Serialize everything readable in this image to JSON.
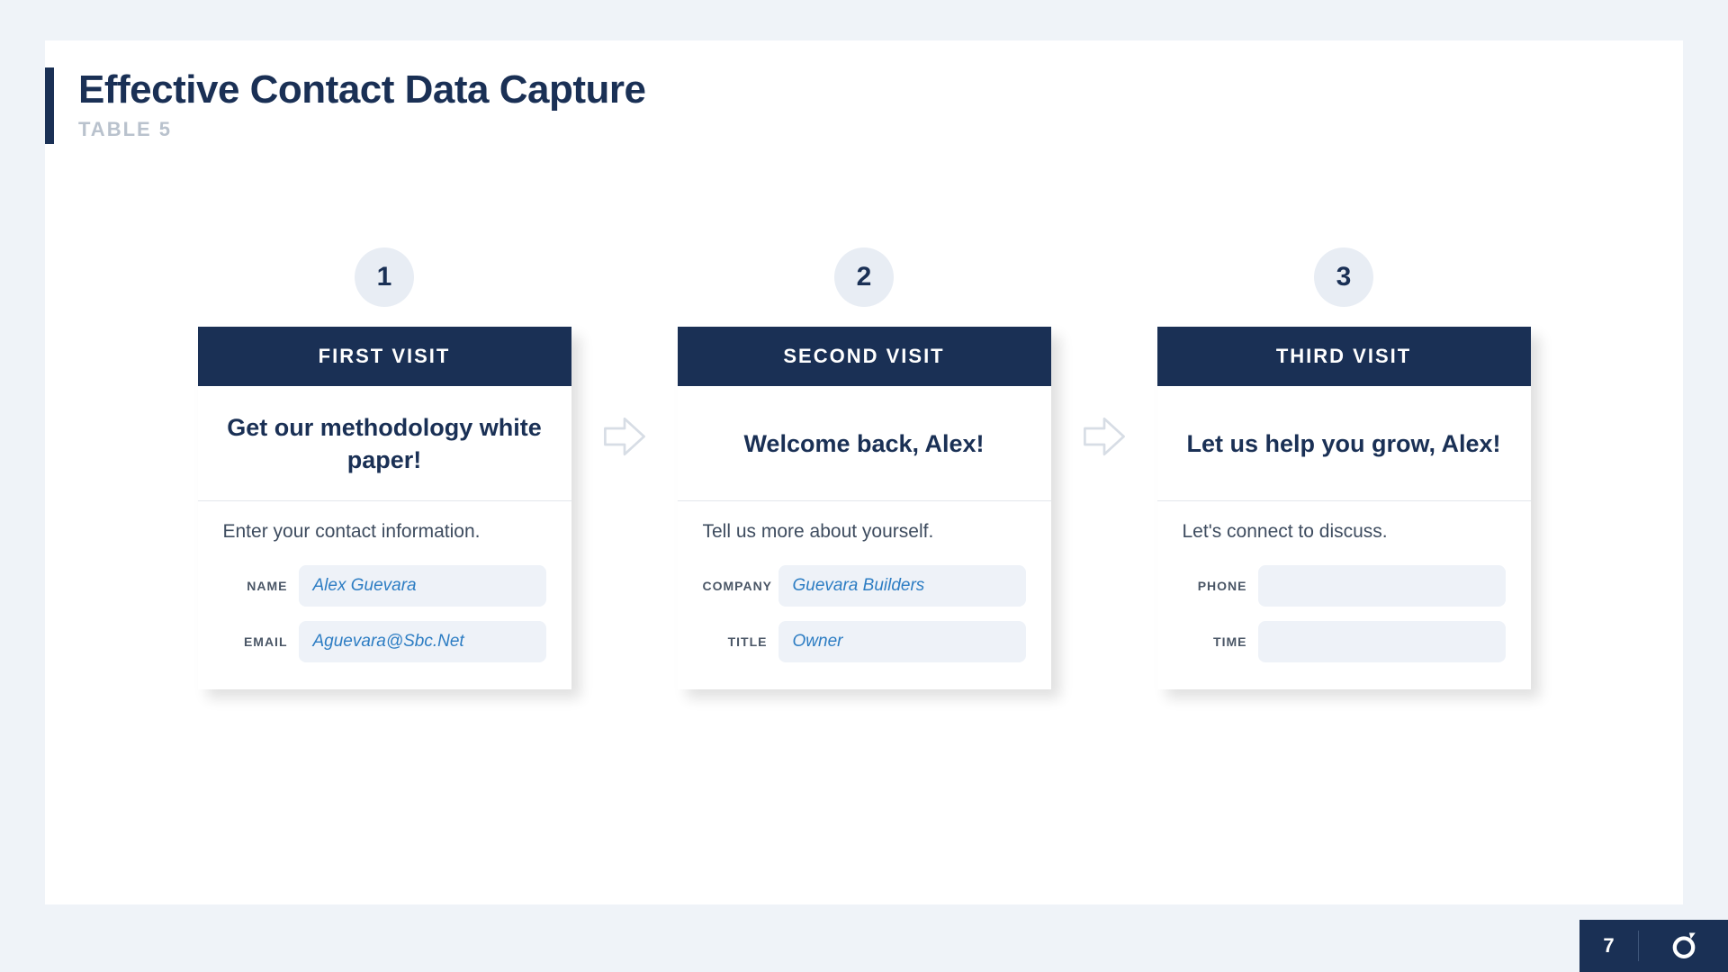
{
  "title": "Effective Contact Data Capture",
  "subtitle": "TABLE 5",
  "page_number": "7",
  "cards": [
    {
      "step": "1",
      "header": "FIRST VISIT",
      "title": "Get our methodology white paper!",
      "instruction": "Enter your contact information.",
      "fields": [
        {
          "label": "NAME",
          "value": "Alex Guevara"
        },
        {
          "label": "EMAIL",
          "value": "Aguevara@Sbc.Net"
        }
      ]
    },
    {
      "step": "2",
      "header": "SECOND VISIT",
      "title": "Welcome back, Alex!",
      "instruction": "Tell us more about yourself.",
      "fields": [
        {
          "label": "COMPANY",
          "value": "Guevara Builders"
        },
        {
          "label": "TITLE",
          "value": "Owner"
        }
      ]
    },
    {
      "step": "3",
      "header": "THIRD VISIT",
      "title": "Let us help you grow, Alex!",
      "instruction": "Let's connect to discuss.",
      "fields": [
        {
          "label": "PHONE",
          "value": ""
        },
        {
          "label": "TIME",
          "value": ""
        }
      ]
    }
  ]
}
